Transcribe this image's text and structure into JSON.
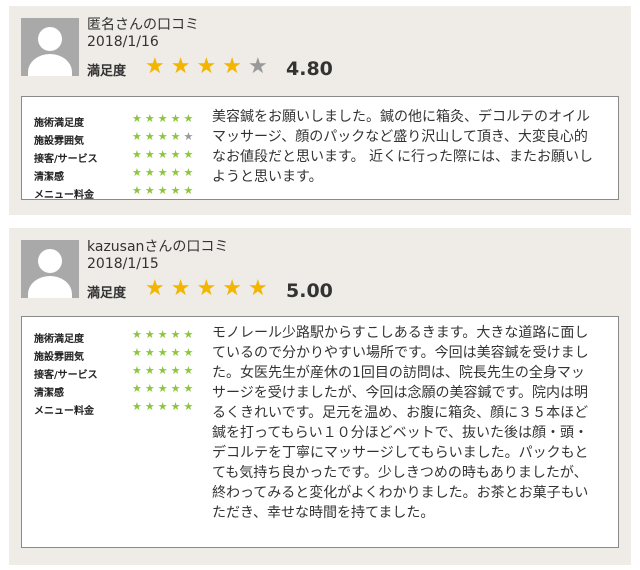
{
  "reviews": [
    {
      "reviewer": "匿名さんの口コミ",
      "date": "2018/1/16",
      "satisfaction_label": "満足度",
      "rating": 4,
      "score": "4.80",
      "categories": [
        {
          "label": "施術満足度",
          "rating": 5
        },
        {
          "label": "施設雰囲気",
          "rating": 4
        },
        {
          "label": "接客/サービス",
          "rating": 5
        },
        {
          "label": "清潔感",
          "rating": 5
        },
        {
          "label": "メニュー料金",
          "rating": 5
        }
      ],
      "comment": "美容鍼をお願いしました。鍼の他に箱灸、デコルテのオイルマッサージ、顔のパックなど盛り沢山して頂き、大変良心的なお値段だと思います。 近くに行った際には、またお願いしようと思います。"
    },
    {
      "reviewer": "kazusanさんの口コミ",
      "date": "2018/1/15",
      "satisfaction_label": "満足度",
      "rating": 5,
      "score": "5.00",
      "categories": [
        {
          "label": "施術満足度",
          "rating": 5
        },
        {
          "label": "施設雰囲気",
          "rating": 5
        },
        {
          "label": "接客/サービス",
          "rating": 5
        },
        {
          "label": "清潔感",
          "rating": 5
        },
        {
          "label": "メニュー料金",
          "rating": 5
        }
      ],
      "comment": "モノレール少路駅からすこしあるきます。大きな道路に面しているので分かりやすい場所です。今回は美容鍼を受けました。女医先生が産休の1回目の訪問は、院長先生の全身マッサージを受けましたが、今回は念願の美容鍼です。院内は明るくきれいです。足元を温め、お腹に箱灸、顔に３５本ほど鍼を打ってもらい１０分ほどベットで、抜いた後は顔・頭・デコルテを丁寧にマッサージしてもらいました。パックもとても気持ち良かったです。少しきつめの時もありましたが、終わってみると変化がよくわかりました。お茶とお菓子もいただき、幸せな時間を持てました。"
    }
  ],
  "colors": {
    "card_bg": "#efebe6",
    "star_gold": "#f2b500",
    "star_green": "#8cc63f",
    "star_gray": "#999999"
  }
}
